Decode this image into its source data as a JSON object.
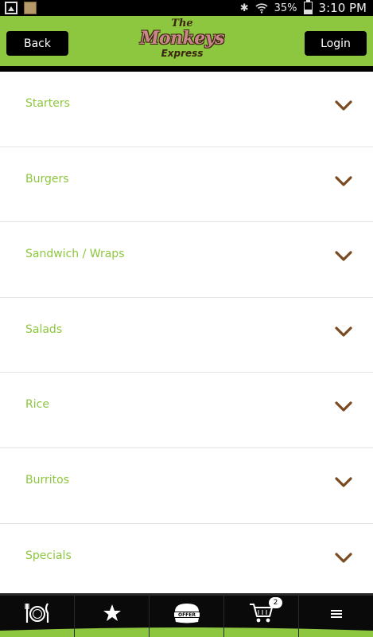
{
  "status_bar": {
    "battery": "35%",
    "time": "3:10 PM"
  },
  "header": {
    "back_label": "Back",
    "login_label": "Login",
    "logo": {
      "the": "The",
      "name": "Monkeys",
      "sub": "Express"
    }
  },
  "menu": {
    "items": [
      {
        "label": "Starters"
      },
      {
        "label": "Burgers"
      },
      {
        "label": "Sandwich / Wraps"
      },
      {
        "label": "Salads"
      },
      {
        "label": "Rice"
      },
      {
        "label": "Burritos"
      },
      {
        "label": "Specials"
      }
    ]
  },
  "tab_bar": {
    "tabs": [
      {
        "icon": "plate-cutlery-icon"
      },
      {
        "icon": "star-icon"
      },
      {
        "icon": "burger-offer-icon",
        "text": "OFFER"
      },
      {
        "icon": "cart-icon",
        "badge": "2"
      },
      {
        "icon": "menu-icon"
      }
    ]
  },
  "colors": {
    "brand_green": "#8dc63f",
    "chevron_brown": "#7a4a20",
    "header_dark": "#000000"
  }
}
